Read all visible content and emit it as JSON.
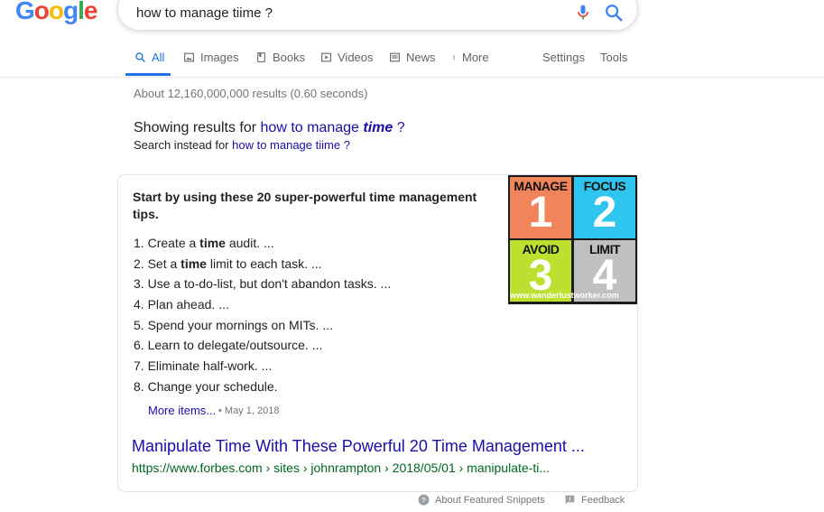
{
  "logo": {
    "letters": [
      "G",
      "o",
      "o",
      "g",
      "l",
      "e"
    ]
  },
  "search": {
    "query": "how to manage tiime ?"
  },
  "tabs": [
    {
      "label": "All",
      "icon": "search-icon"
    },
    {
      "label": "Images",
      "icon": "image-icon"
    },
    {
      "label": "Books",
      "icon": "book-icon"
    },
    {
      "label": "Videos",
      "icon": "video-icon"
    },
    {
      "label": "News",
      "icon": "news-icon"
    },
    {
      "label": "More",
      "icon": "more-vertical-icon"
    },
    {
      "label": "Settings"
    },
    {
      "label": "Tools"
    }
  ],
  "stats": "About 12,160,000,000 results (0.60 seconds)",
  "correction": {
    "showing_prefix": "Showing results for ",
    "corrected_plain": "how to manage ",
    "corrected_bold": "time",
    "corrected_suffix": " ?",
    "instead_prefix": "Search instead for ",
    "original": "how to manage tiime ?"
  },
  "snippet": {
    "heading": "Start by using these 20 super-powerful time management tips.",
    "steps": [
      {
        "num": "1. ",
        "pre": "Create a ",
        "bold": "time",
        "post": " audit. ..."
      },
      {
        "num": "2. ",
        "pre": "Set a ",
        "bold": "time",
        "post": " limit to each task. ..."
      },
      {
        "num": "3. ",
        "pre": "Use a to-do-list, but don't abandon tasks. ...",
        "bold": "",
        "post": ""
      },
      {
        "num": "4. ",
        "pre": "Plan ahead. ...",
        "bold": "",
        "post": ""
      },
      {
        "num": "5. ",
        "pre": "Spend your mornings on MITs. ...",
        "bold": "",
        "post": ""
      },
      {
        "num": "6. ",
        "pre": "Learn to delegate/outsource. ...",
        "bold": "",
        "post": ""
      },
      {
        "num": "7. ",
        "pre": "Eliminate half-work. ...",
        "bold": "",
        "post": ""
      },
      {
        "num": "8. ",
        "pre": "Change your schedule.",
        "bold": "",
        "post": ""
      }
    ],
    "more_label": "More items...",
    "date": "May 1, 2018",
    "result_title": "Manipulate Time With These Powerful 20 Time Management ...",
    "result_url": "https://www.forbes.com › sites › johnrampton › 2018/05/01 › manipulate-ti...",
    "image": {
      "quadrants": [
        {
          "word": "MANAGE",
          "number": "1",
          "color": "#f0845a"
        },
        {
          "word": "FOCUS",
          "number": "2",
          "color": "#2ec6ef"
        },
        {
          "word": "AVOID",
          "number": "3",
          "color": "#bde030"
        },
        {
          "word": "LIMIT",
          "number": "4",
          "color": "#c0c0c0"
        }
      ],
      "watermark": "www.wanderlustworker.com"
    }
  },
  "footer": {
    "about": "About Featured Snippets",
    "feedback": "Feedback"
  },
  "colors": {
    "link": "#1a0dab",
    "url": "#006621",
    "accent": "#1a73e8",
    "muted": "#70757a"
  }
}
